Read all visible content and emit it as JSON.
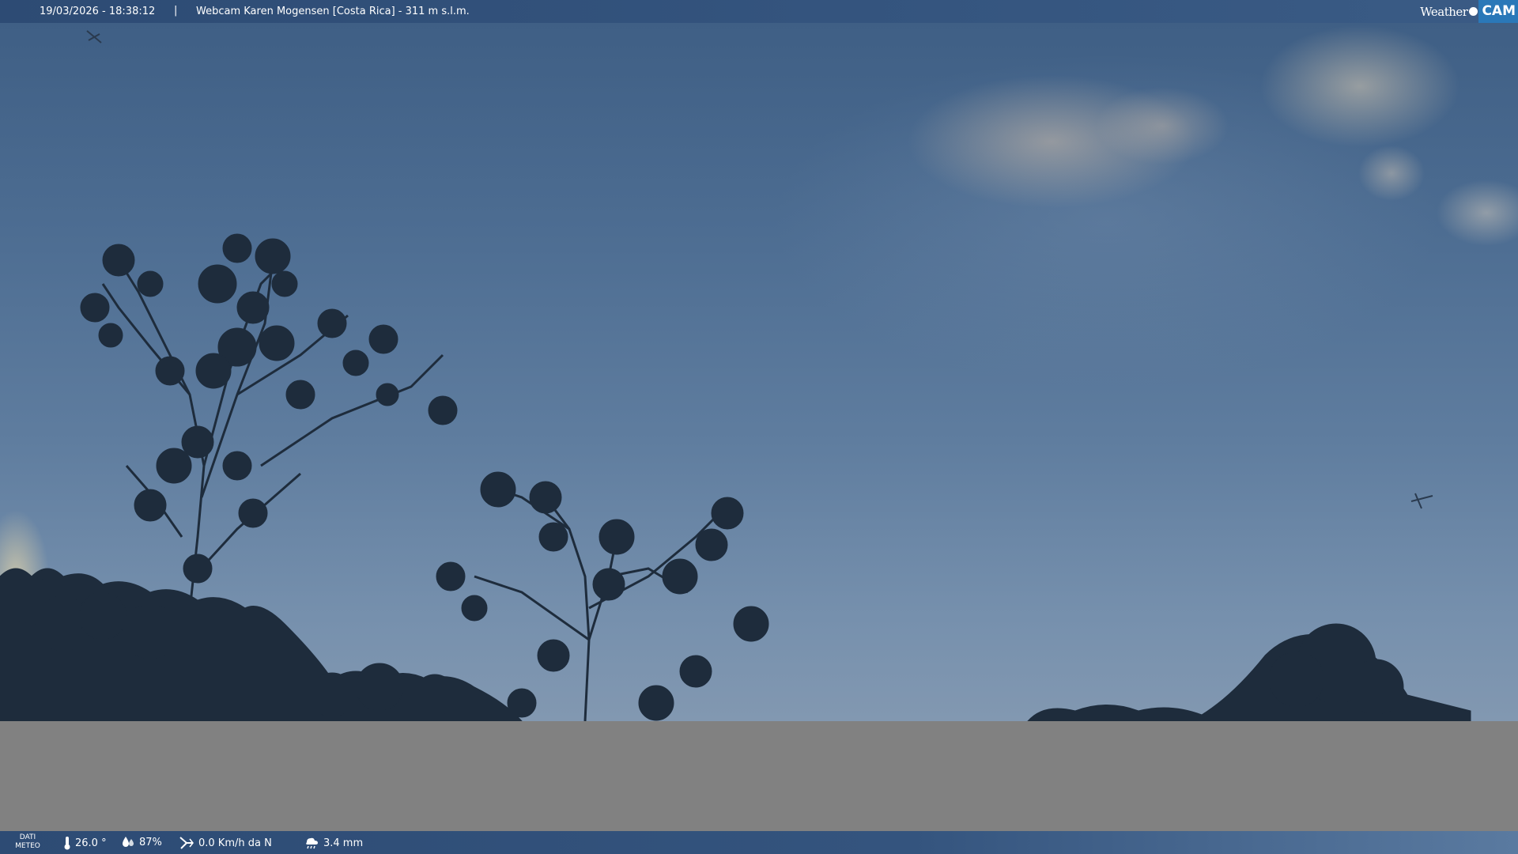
{
  "header": {
    "datetime": "19/03/2026 - 18:38:12",
    "separator": "|",
    "title": "Webcam Karen Mogensen [Costa Rica]  - 311 m s.l.m.",
    "logo_text_left": "Weather",
    "logo_text_right": "CAM"
  },
  "meteo": {
    "label_line1": "DATI",
    "label_line2": "METEO",
    "temperature": "26.0 °",
    "humidity": "87%",
    "wind": "0.0 Km/h da N",
    "rain": "3.4 mm"
  },
  "icons": {
    "temperature": "thermometer-icon",
    "humidity": "humidity-icon",
    "wind": "wind-icon",
    "rain": "rain-icon"
  },
  "colors": {
    "bar": "#2d4b74",
    "logo_accent": "#2a78b8",
    "placeholder": "#818181"
  }
}
